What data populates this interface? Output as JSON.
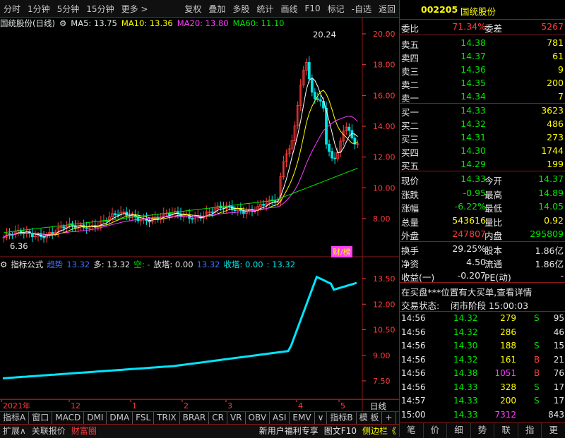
{
  "toolbar": {
    "left_items": [
      "分时",
      "1分钟",
      "5分钟",
      "15分钟",
      "更多 >"
    ],
    "right_items": [
      "复权",
      "叠加",
      "多股",
      "统计",
      "画线",
      "F10",
      "标记",
      "-自选",
      "返回"
    ]
  },
  "chart_header": {
    "title": "国统股份(日线)",
    "ma5": "MA5: 13.75",
    "ma10": "MA10: 13.36",
    "ma20": "MA20: 13.80",
    "ma60": "MA60: 11.10"
  },
  "price_axis": {
    "labels": [
      "20.00",
      "18.00",
      "16.00",
      "14.00",
      "12.00",
      "10.00",
      "8.00"
    ]
  },
  "annotations": {
    "high": "20.24",
    "low": "6.36",
    "badge": "财/榜"
  },
  "indicator_header": {
    "name": "指标公式",
    "trend_label": "趋势",
    "trend_value": "13.32",
    "long_label": "多: 13.32",
    "short_label": "空: -",
    "release_label": "放塔: 0.00",
    "v2": "13.32",
    "recover_label": "收塔: 0.00",
    "v3": ": 13.32"
  },
  "indicator_axis": {
    "labels": [
      "13.50",
      "12.00",
      "10.50",
      "9.00",
      "7.50"
    ]
  },
  "time_axis": {
    "labels": [
      "2021年",
      "12",
      "1",
      "2",
      "3",
      "4",
      "5"
    ],
    "period": "日线"
  },
  "tabs": [
    "指标A",
    "窗口",
    "MACD",
    "DMI",
    "DMA",
    "FSL",
    "TRIX",
    "BRAR",
    "CR",
    "VR",
    "OBV",
    "ASI",
    "EMV",
    "∨",
    "指标B",
    "模 板",
    "+",
    "-"
  ],
  "status_bar": {
    "left": [
      "扩展∧",
      "关联报价",
      "财富圈"
    ],
    "right": [
      "新用户福利专享",
      "图文F10",
      "侧边栏《"
    ]
  },
  "panel": {
    "code": "002205",
    "name": "国统股份",
    "weibi_label": "委比",
    "weibi": "71.34%",
    "weicha_label": "委差",
    "weicha": "5267",
    "asks": [
      {
        "label": "卖五",
        "price": "14.38",
        "vol": "781"
      },
      {
        "label": "卖四",
        "price": "14.37",
        "vol": "61"
      },
      {
        "label": "卖三",
        "price": "14.36",
        "vol": "9"
      },
      {
        "label": "卖二",
        "price": "14.35",
        "vol": "200"
      },
      {
        "label": "卖一",
        "price": "14.34",
        "vol": "7"
      }
    ],
    "bids": [
      {
        "label": "买一",
        "price": "14.33",
        "vol": "3623"
      },
      {
        "label": "买二",
        "price": "14.32",
        "vol": "486"
      },
      {
        "label": "买三",
        "price": "14.31",
        "vol": "273"
      },
      {
        "label": "买四",
        "price": "14.30",
        "vol": "1744"
      },
      {
        "label": "买五",
        "price": "14.29",
        "vol": "199"
      }
    ],
    "stats": [
      {
        "l1": "现价",
        "v1": "14.33",
        "c1": "green",
        "l2": "今开",
        "v2": "14.37",
        "c2": "green"
      },
      {
        "l1": "涨跌",
        "v1": "-0.95",
        "c1": "green",
        "l2": "最高",
        "v2": "14.89",
        "c2": "green"
      },
      {
        "l1": "涨幅",
        "v1": "-6.22%",
        "c1": "green",
        "l2": "最低",
        "v2": "14.05",
        "c2": "green"
      },
      {
        "l1": "总量",
        "v1": "543616",
        "c1": "yellow",
        "l2": "量比",
        "v2": "0.92",
        "c2": "yellow"
      },
      {
        "l1": "外盘",
        "v1": "247807",
        "c1": "red",
        "l2": "内盘",
        "v2": "295809",
        "c2": "green"
      }
    ],
    "stats2": [
      {
        "l1": "换手",
        "v1": "29.25%",
        "l2": "股本",
        "v2": "1.86亿"
      },
      {
        "l1": "净资",
        "v1": "4.50",
        "l2": "流通",
        "v2": "1.86亿"
      },
      {
        "l1": "收益(一)",
        "v1": "-0.207",
        "l2": "PE(动)",
        "v2": "-"
      }
    ],
    "notice": "在买盘***位置有大买单,查看详情",
    "trade_status_label": "交易状态:",
    "trade_status": "闭市阶段 15:00:03",
    "ticks": [
      {
        "t": "14:56",
        "p": "14.32",
        "v": "279",
        "s": "S",
        "n": "95",
        "vc": "yellow"
      },
      {
        "t": "14:56",
        "p": "14.32",
        "v": "286",
        "s": "",
        "n": "46",
        "vc": "yellow"
      },
      {
        "t": "14:56",
        "p": "14.30",
        "v": "188",
        "s": "S",
        "n": "15",
        "vc": "yellow"
      },
      {
        "t": "14:56",
        "p": "14.32",
        "v": "161",
        "s": "B",
        "n": "21",
        "vc": "yellow"
      },
      {
        "t": "14:56",
        "p": "14.38",
        "v": "1051",
        "s": "B",
        "n": "76",
        "vc": "magenta"
      },
      {
        "t": "14:56",
        "p": "14.33",
        "v": "328",
        "s": "S",
        "n": "17",
        "vc": "yellow"
      },
      {
        "t": "14:57",
        "p": "14.33",
        "v": "200",
        "s": "S",
        "n": "17",
        "vc": "yellow"
      },
      {
        "t": "15:00",
        "p": "14.33",
        "v": "7312",
        "s": "",
        "n": "843",
        "vc": "magenta"
      }
    ],
    "tabs": [
      "笔",
      "价",
      "细",
      "势",
      "联",
      "指",
      "更"
    ]
  }
}
